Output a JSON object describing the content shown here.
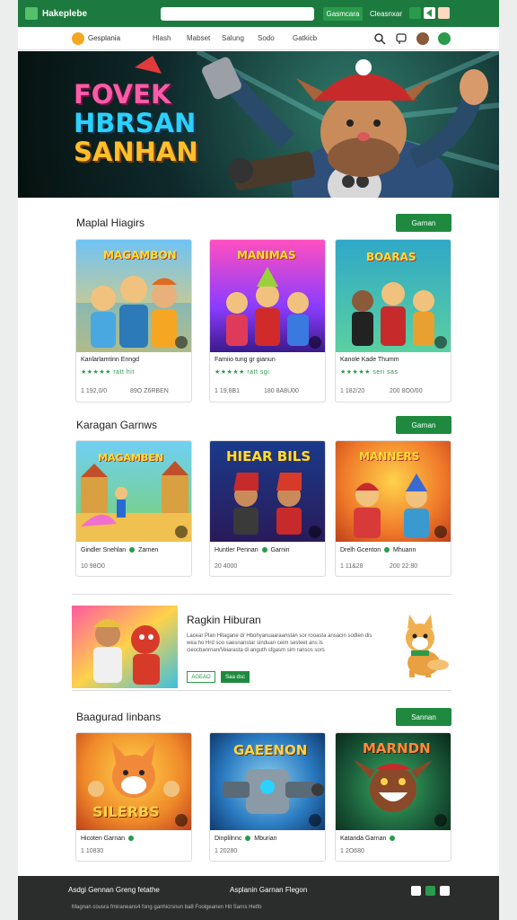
{
  "topbar": {
    "brand": "Hakeplebe",
    "btn1": "Gasmcara",
    "btn2": "Cleasnxar"
  },
  "nav": {
    "brand": "Gesplania",
    "items": [
      "Hlash",
      "Mabset",
      "Salung",
      "Sodo",
      "Gatkicb"
    ],
    "icons": [
      "search-icon",
      "chat-icon",
      "avatar",
      "status-icon"
    ]
  },
  "hero": {
    "line1": "FOVEK",
    "line2": "HBRSAN",
    "line3": "SANHAN"
  },
  "sections": [
    {
      "title": "Maplal Hiagirs",
      "button": "Garnan",
      "cards": [
        {
          "name": "Kanlarlamtinn Enngd",
          "stars": "★★★★★ ratt hit",
          "meta1": "1 192,0/0",
          "meta2": "89O Z6RBEN"
        },
        {
          "name": "Famiio tung gr gianun",
          "stars": "★★★★★ ratt sgi",
          "meta1": "1 19,8B1",
          "meta2": "180 8A8U00"
        },
        {
          "name": "Kanole Kade Thumm",
          "stars": "★★★★★ seri sas",
          "meta1": "1 182/20",
          "meta2": "200 8O0/00"
        }
      ]
    },
    {
      "title": "Karagan Garnws",
      "button": "Garnan",
      "cards": [
        {
          "name": "Gindler Snehlan",
          "extra": "Zarnen",
          "meta1": "10 98O0"
        },
        {
          "name": "Huntler Pennan",
          "extra": "Garnin",
          "meta1": "20 4000"
        },
        {
          "name": "Drelh Gcenton",
          "extra": "Mhuann",
          "meta1": "1 11&28",
          "meta2": "200 22:80"
        }
      ]
    },
    {
      "title": "Baagurad Iinbans",
      "button": "Sannan",
      "cards": [
        {
          "name": "Hicoten Garnan",
          "meta1": "1 10830"
        },
        {
          "name": "Dinplilnnc",
          "extra": "Mburian",
          "meta1": "1 20280"
        },
        {
          "name": "Katanda Garnan",
          "meta1": "1 2O680"
        }
      ]
    }
  ],
  "thumb_titles": [
    "MAGAMBON",
    "MANIMAS",
    "BOARAS",
    "MAGAMBEN",
    "HIEAR BILS",
    "MANNERS",
    "SILERBS",
    "GAEENON",
    "MARNDN"
  ],
  "featured": {
    "title": "Ragkin Hiburan",
    "desc": "Lacear Plan Hitagane dr Hbohyanuaaraanstan sor rooasta ansacin sodlen dis wea ho Hrd soo saesnanstar sinduan ceim sesteet ans ls cieocbanrnan/Veiarasta di anguth sfgasm sim ransos sors",
    "btn1": "AGEAO",
    "btn2": "Saa dsc"
  },
  "footer": {
    "left": "Asdgi Gennan Greng fetathe",
    "mid": "Asplanin Garnan Flegon",
    "bottom": "Magnan cousra frniraneans4 fong ganhicrsnun ba8 Foolgeanen Hit Sarns Hetfo"
  },
  "colors": {
    "green": "#1f8a3f",
    "topbar": "#1d7a3e",
    "footer": "#2a2d2c"
  }
}
